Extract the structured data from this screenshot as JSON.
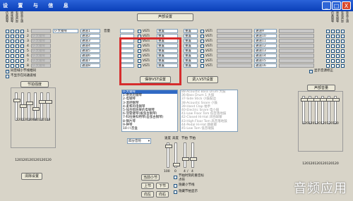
{
  "window": {
    "title": "设 置 与 信 息",
    "controls": [
      "_",
      "□",
      "X"
    ]
  },
  "header_button": "声部设置",
  "left_column_labels": [
    "仿真钢琴",
    "原味钢琴",
    "有效声部",
    "转音主调"
  ],
  "right_column_labels": [
    "仿真钢琴",
    "原味钢琴",
    "有效声部",
    "转音主调"
  ],
  "voice_rows": [
    {
      "num": "1",
      "name": "0-大钢琴",
      "channel": "通道1",
      "volume": "音量",
      "vst": "VSTi",
      "mode": "重置"
    },
    {
      "num": "2",
      "name": "0-大钢琴",
      "channel": "通道2",
      "volume": "",
      "vst": "VSTi",
      "mode": "重置"
    },
    {
      "num": "3",
      "name": "0-大钢琴",
      "channel": "通道3",
      "volume": "",
      "vst": "VSTi",
      "mode": "重置"
    },
    {
      "num": "4",
      "name": "0-大钢琴",
      "channel": "通道4",
      "volume": "",
      "vst": "VSTi",
      "mode": "重置"
    },
    {
      "num": "5",
      "name": "0-大钢琴",
      "channel": "通道5",
      "volume": "",
      "vst": "VSTi",
      "mode": "重置"
    },
    {
      "num": "6",
      "name": "0-大钢琴",
      "channel": "通道6",
      "volume": "",
      "vst": "VSTi",
      "mode": "重置"
    },
    {
      "num": "7",
      "name": "0-大钢琴",
      "channel": "通道7",
      "volume": "",
      "vst": "VSTi",
      "mode": "重置"
    },
    {
      "num": "8",
      "name": "0-大钢琴",
      "channel": "通道8",
      "volume": "",
      "vst": "VSTi",
      "mode": "重置"
    }
  ],
  "right_rows": [
    {
      "mode": "重置",
      "vst": "VSTi",
      "channel": "通道9"
    },
    {
      "mode": "重置",
      "vst": "VSTi",
      "channel": "通道10"
    },
    {
      "mode": "重置",
      "vst": "VSTi",
      "channel": "通道11"
    },
    {
      "mode": "重置",
      "vst": "VSTi",
      "channel": "通道12"
    },
    {
      "mode": "重置",
      "vst": "VSTi",
      "channel": "通道13"
    },
    {
      "mode": "重置",
      "vst": "VSTi",
      "channel": "通道14"
    },
    {
      "mode": "重置",
      "vst": "VSTi",
      "channel": "通道15"
    },
    {
      "mode": "重置",
      "vst": "VSTi",
      "channel": "通道16"
    }
  ],
  "options": {
    "sync_left": "同音域小节线相同",
    "no_sync": "不显示在同通道线",
    "show_right": "显示音源修正"
  },
  "left_panel_title": "节拍强度",
  "right_panel_title": "声部音量",
  "left_slider_values": [
    "120",
    "120",
    "100",
    "90",
    "120",
    "120"
  ],
  "left_slider_values2": [
    "120",
    "120",
    "120",
    "120",
    "120",
    "120"
  ],
  "right_slider_values": [
    "120",
    "120",
    "120",
    "120",
    "120",
    "120"
  ],
  "right_slider_values2": [
    "120",
    "120",
    "120",
    "120",
    "120",
    "120"
  ],
  "save_vst": "保存VST设置",
  "load_vst": "调入VST设置",
  "instrument_list": [
    "0-大钢琴",
    "1-明亮的钢琴",
    "2-电钢琴",
    "3-酒吧钢琴",
    "4-柔和的电钢琴",
    "5-加合唱效果的电钢琴",
    "6-羽管键琴(拨弦古钢琴)",
    "7-科拉维科特琴(击弦古钢琴)",
    "8-钢片琴",
    "9-钟琴",
    "10-八音盒"
  ],
  "instrument_list2": [
    "88-Acoustic Bass Drum 大鼓",
    "36-Bass Drum 1 大鼓",
    "37-Side Stick 小鼓鼓边",
    "38-Acoustic Snare 小鼓",
    "39-Hand Clap 拍手",
    "40-Electric Snare 电小鼓",
    "41-Low Floor Tom 低音落地鼓",
    "42-Closed Hi-Hat 闭合踩镲",
    "43-High Floor Tom 高音落地鼓",
    "44-Pedal Hi-Hat 踏板镲",
    "45-Low Tom 低音嗵鼓"
  ],
  "dropdown": "四分音符",
  "speed_labels": {
    "speed": "速度",
    "height": "高度",
    "beat": "节拍",
    "beat2": "节拍"
  },
  "speed_values": [
    "100",
    "0",
    "4",
    "/",
    "4"
  ],
  "bottom_buttons": {
    "reset": "清除设置",
    "play": "当前小节",
    "next": "下节",
    "prev": "上节",
    "forward": "向左",
    "backward": "向右"
  },
  "bottom_options": {
    "opt1": "节拍时刻的重音标",
    "opt2": "点符",
    "opt3": "隐藏小节线",
    "opt4": "隐藏节拍显示"
  },
  "watermark": "音频应用"
}
